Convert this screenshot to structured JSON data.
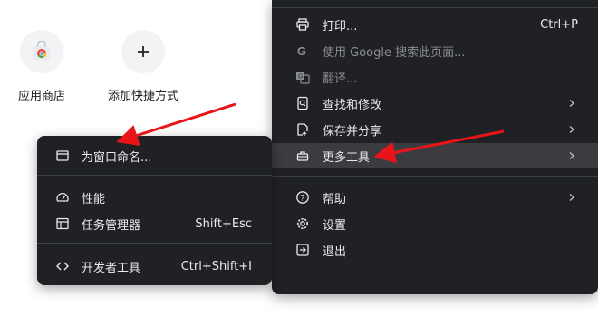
{
  "shortcuts": [
    {
      "label": "应用商店",
      "icon": "chrome-web-store-icon"
    },
    {
      "label": "添加快捷方式",
      "icon": "plus-icon"
    }
  ],
  "main_menu": {
    "items": [
      {
        "label": "打印...",
        "shortcut": "Ctrl+P",
        "icon": "print-icon"
      },
      {
        "label": "使用 Google 搜索此页面...",
        "icon": "google-g-icon",
        "disabled": true
      },
      {
        "label": "翻译...",
        "icon": "translate-icon",
        "disabled": true
      },
      {
        "label": "查找和修改",
        "icon": "find-icon",
        "submenu": true
      },
      {
        "label": "保存并分享",
        "icon": "save-share-icon",
        "submenu": true
      },
      {
        "label": "更多工具",
        "icon": "toolbox-icon",
        "submenu": true,
        "highlighted": true
      },
      {
        "label": "帮助",
        "icon": "help-icon",
        "submenu": true
      },
      {
        "label": "设置",
        "icon": "gear-icon"
      },
      {
        "label": "退出",
        "icon": "exit-icon"
      }
    ]
  },
  "sub_menu": {
    "items": [
      {
        "label": "为窗口命名...",
        "icon": "window-icon"
      },
      {
        "label": "性能",
        "icon": "performance-gauge-icon"
      },
      {
        "label": "任务管理器",
        "shortcut": "Shift+Esc",
        "icon": "task-manager-icon"
      },
      {
        "label": "开发者工具",
        "shortcut": "Ctrl+Shift+I",
        "icon": "code-icon"
      }
    ]
  },
  "colors": {
    "menu_bg": "#202124",
    "menu_text": "#e8eaed",
    "highlight_bg": "#3b3c3f",
    "arrow": "#e8141a"
  }
}
